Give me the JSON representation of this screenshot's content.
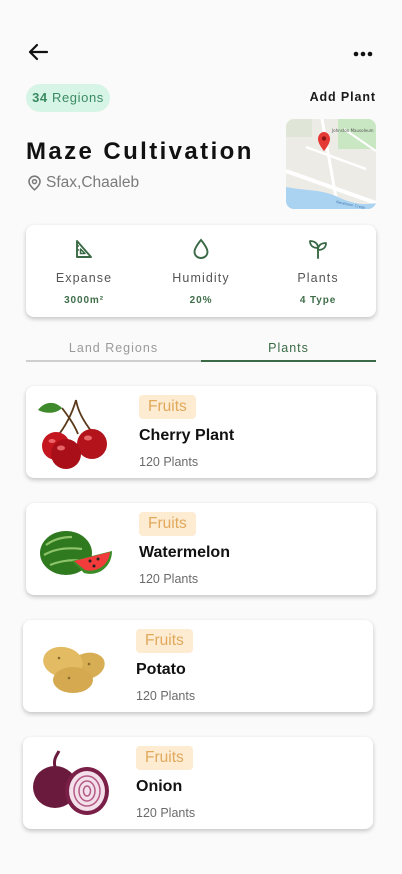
{
  "header": {
    "regions_count": "34",
    "regions_label": "Regions",
    "add_plant": "Add Plant"
  },
  "farm": {
    "name": "Maze Cultivation",
    "location": "Sfax,Chaaleb",
    "map_labels": [
      "Johnston Mausoleum",
      "Newtown Creek"
    ]
  },
  "stats": [
    {
      "icon": "set-square-icon",
      "label": "Expanse",
      "value": "3000m²"
    },
    {
      "icon": "droplet-icon",
      "label": "Humidity",
      "value": "20%"
    },
    {
      "icon": "sprout-icon",
      "label": "Plants",
      "value": "4 Type"
    }
  ],
  "tabs": [
    {
      "label": "Land Regions",
      "active": false
    },
    {
      "label": "Plants",
      "active": true
    }
  ],
  "plants": [
    {
      "name": "Cherry Plant",
      "category": "Fruits",
      "count": "120 Plants",
      "image": "cherry-image"
    },
    {
      "name": "Watermelon",
      "category": "Fruits",
      "count": "120 Plants",
      "image": "watermelon-image"
    },
    {
      "name": "Potato",
      "category": "Fruits",
      "count": "120 Plants",
      "image": "potato-image"
    },
    {
      "name": "Onion",
      "category": "Fruits",
      "count": "120 Plants",
      "image": "onion-image"
    }
  ],
  "colors": {
    "accent_green": "#3a6a45",
    "badge_green_bg": "#d7f5e6",
    "badge_orange_bg": "#fdebd2",
    "badge_orange_text": "#e0a95c"
  }
}
